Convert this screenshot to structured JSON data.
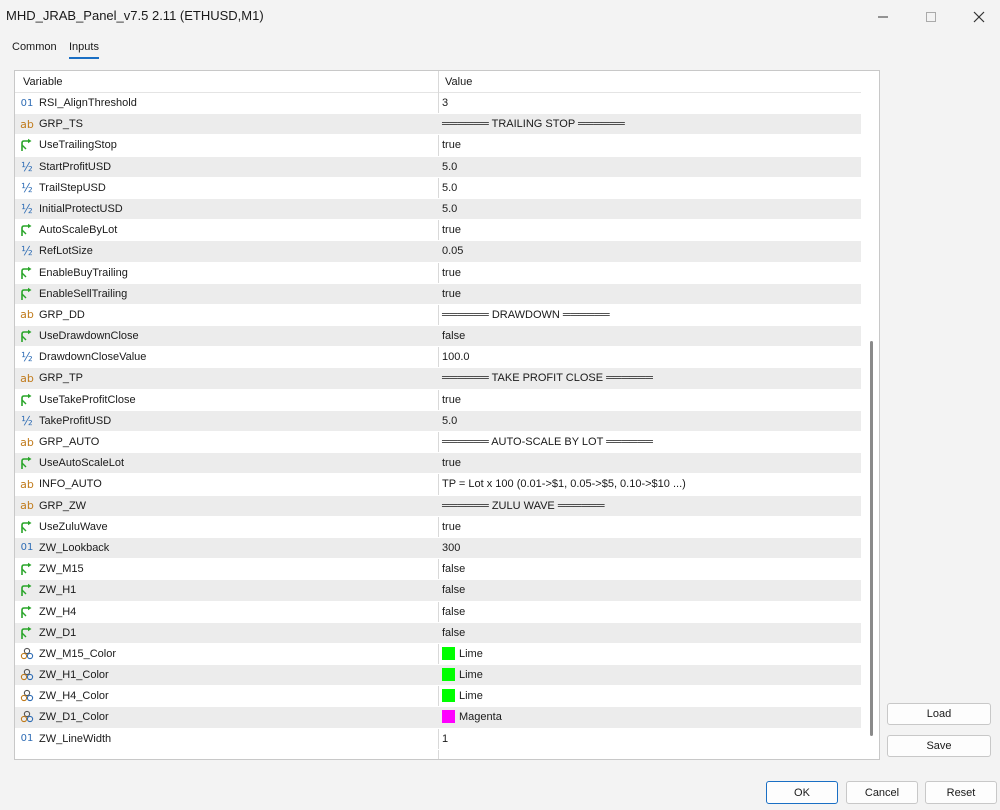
{
  "window": {
    "title": "MHD_JRAB_Panel_v7.5 2.11 (ETHUSD,M1)"
  },
  "tabs": [
    {
      "label": "Common"
    },
    {
      "label": "Inputs"
    }
  ],
  "grid": {
    "headers": {
      "variable": "Variable",
      "value": "Value"
    },
    "rows": [
      {
        "type": "int",
        "icon": "int-type-icon",
        "name": "RSI_AlignThreshold",
        "value": "3"
      },
      {
        "type": "string",
        "icon": "string-type-icon",
        "name": "GRP_TS",
        "value": "══════ TRAILING STOP ══════"
      },
      {
        "type": "bool",
        "icon": "bool-type-icon",
        "name": "UseTrailingStop",
        "value": "true"
      },
      {
        "type": "double",
        "icon": "double-type-icon",
        "name": "StartProfitUSD",
        "value": "5.0"
      },
      {
        "type": "double",
        "icon": "double-type-icon",
        "name": "TrailStepUSD",
        "value": "5.0"
      },
      {
        "type": "double",
        "icon": "double-type-icon",
        "name": "InitialProtectUSD",
        "value": "5.0"
      },
      {
        "type": "bool",
        "icon": "bool-type-icon",
        "name": "AutoScaleByLot",
        "value": "true"
      },
      {
        "type": "double",
        "icon": "double-type-icon",
        "name": "RefLotSize",
        "value": "0.05"
      },
      {
        "type": "bool",
        "icon": "bool-type-icon",
        "name": "EnableBuyTrailing",
        "value": "true"
      },
      {
        "type": "bool",
        "icon": "bool-type-icon",
        "name": "EnableSellTrailing",
        "value": "true"
      },
      {
        "type": "string",
        "icon": "string-type-icon",
        "name": "GRP_DD",
        "value": "══════ DRAWDOWN ══════"
      },
      {
        "type": "bool",
        "icon": "bool-type-icon",
        "name": "UseDrawdownClose",
        "value": "false"
      },
      {
        "type": "double",
        "icon": "double-type-icon",
        "name": "DrawdownCloseValue",
        "value": "100.0"
      },
      {
        "type": "string",
        "icon": "string-type-icon",
        "name": "GRP_TP",
        "value": "══════ TAKE PROFIT CLOSE ══════"
      },
      {
        "type": "bool",
        "icon": "bool-type-icon",
        "name": "UseTakeProfitClose",
        "value": "true"
      },
      {
        "type": "double",
        "icon": "double-type-icon",
        "name": "TakeProfitUSD",
        "value": "5.0"
      },
      {
        "type": "string",
        "icon": "string-type-icon",
        "name": "GRP_AUTO",
        "value": "══════ AUTO-SCALE BY LOT ══════"
      },
      {
        "type": "bool",
        "icon": "bool-type-icon",
        "name": "UseAutoScaleLot",
        "value": "true"
      },
      {
        "type": "string",
        "icon": "string-type-icon",
        "name": "INFO_AUTO",
        "value": "TP = Lot x 100  (0.01->$1, 0.05->$5, 0.10->$10 ...)"
      },
      {
        "type": "string",
        "icon": "string-type-icon",
        "name": "GRP_ZW",
        "value": "══════ ZULU WAVE ══════"
      },
      {
        "type": "bool",
        "icon": "bool-type-icon",
        "name": "UseZuluWave",
        "value": "true"
      },
      {
        "type": "int",
        "icon": "int-type-icon",
        "name": "ZW_Lookback",
        "value": "300"
      },
      {
        "type": "bool",
        "icon": "bool-type-icon",
        "name": "ZW_M15",
        "value": "false"
      },
      {
        "type": "bool",
        "icon": "bool-type-icon",
        "name": "ZW_H1",
        "value": "false"
      },
      {
        "type": "bool",
        "icon": "bool-type-icon",
        "name": "ZW_H4",
        "value": "false"
      },
      {
        "type": "bool",
        "icon": "bool-type-icon",
        "name": "ZW_D1",
        "value": "false"
      },
      {
        "type": "color",
        "icon": "color-type-icon",
        "name": "ZW_M15_Color",
        "value": "Lime",
        "swatch": "#00ff00"
      },
      {
        "type": "color",
        "icon": "color-type-icon",
        "name": "ZW_H1_Color",
        "value": "Lime",
        "swatch": "#00ff00"
      },
      {
        "type": "color",
        "icon": "color-type-icon",
        "name": "ZW_H4_Color",
        "value": "Lime",
        "swatch": "#00ff00"
      },
      {
        "type": "color",
        "icon": "color-type-icon",
        "name": "ZW_D1_Color",
        "value": "Magenta",
        "swatch": "#ff00ff"
      },
      {
        "type": "int",
        "icon": "int-type-icon",
        "name": "ZW_LineWidth",
        "value": "1"
      }
    ]
  },
  "side_buttons": {
    "load": "Load",
    "save": "Save"
  },
  "footer": {
    "ok": "OK",
    "cancel": "Cancel",
    "reset": "Reset"
  },
  "colors": {
    "accent": "#1a6fc4",
    "row_alt": "#ececec",
    "string_icon": "#c07a1a",
    "bool_icon": "#2aa52a",
    "int_icon": "#2f6db5"
  }
}
